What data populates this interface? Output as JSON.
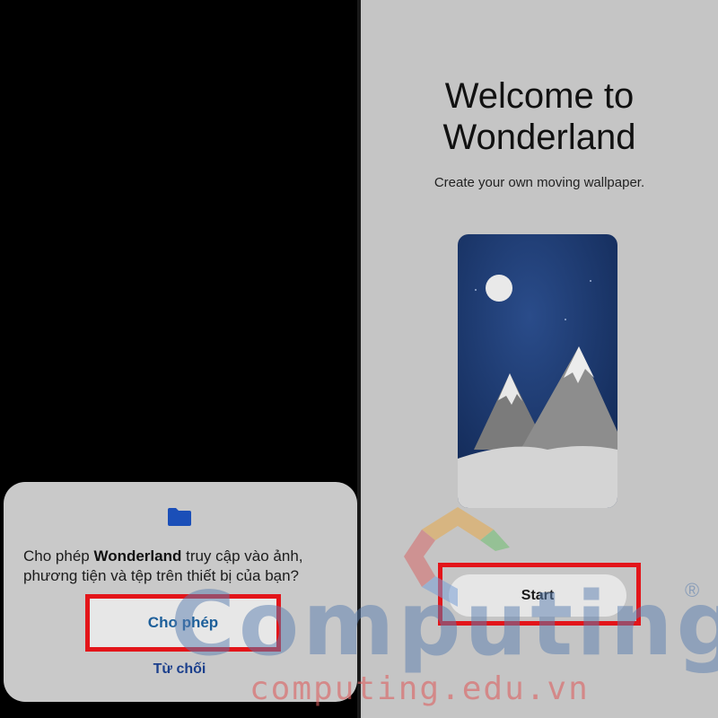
{
  "permission_dialog": {
    "message_prefix": "Cho phép ",
    "app_name": "Wonderland",
    "message_suffix": " truy cập vào ảnh, phương tiện và tệp trên thiết bị của bạn?",
    "allow_label": "Cho phép",
    "deny_label": "Từ chối",
    "icon": "folder-icon",
    "accent_color": "#1d5f9a"
  },
  "welcome": {
    "title_line1": "Welcome to",
    "title_line2": "Wonderland",
    "subtitle": "Create your own moving wallpaper.",
    "start_label": "Start"
  },
  "highlight_color": "#e3151a",
  "watermark": {
    "brand": "Computing",
    "registered": "®",
    "url": "computing.edu.vn"
  }
}
